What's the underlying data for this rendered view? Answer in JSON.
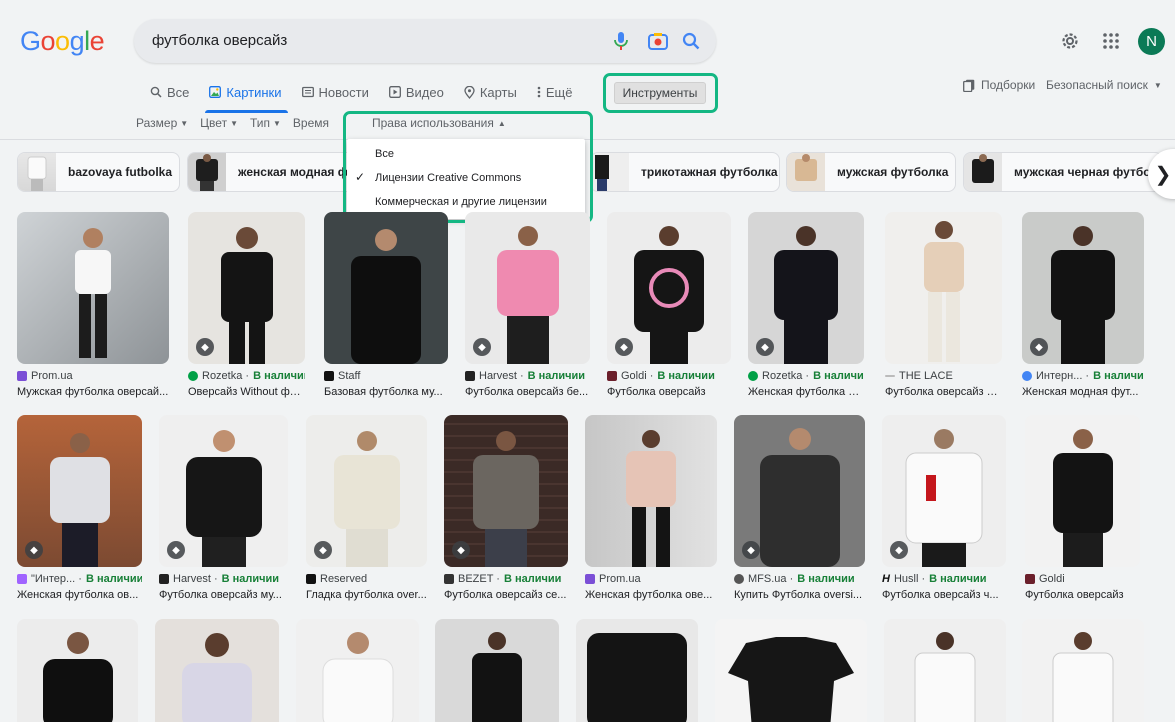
{
  "header": {
    "logo_letters": [
      {
        "ch": "G",
        "color": "#4285f4"
      },
      {
        "ch": "o",
        "color": "#ea4335"
      },
      {
        "ch": "o",
        "color": "#fbbc05"
      },
      {
        "ch": "g",
        "color": "#4285f4"
      },
      {
        "ch": "l",
        "color": "#34a853"
      },
      {
        "ch": "e",
        "color": "#ea4335"
      }
    ],
    "search_query": "футболка оверсайз",
    "avatar_letter": "N"
  },
  "tabs": [
    {
      "label": "Все",
      "icon": "search-icon",
      "active": false
    },
    {
      "label": "Картинки",
      "icon": "image-icon",
      "active": true
    },
    {
      "label": "Новости",
      "icon": "news-icon",
      "active": false
    },
    {
      "label": "Видео",
      "icon": "video-icon",
      "active": false
    },
    {
      "label": "Карты",
      "icon": "map-pin-icon",
      "active": false
    },
    {
      "label": "Ещё",
      "icon": "more-vert-icon",
      "active": false
    }
  ],
  "tools_label": "Инструменты",
  "right_links": {
    "collections": "Подборки",
    "safesearch": "Безопасный поиск"
  },
  "filters": [
    "Размер",
    "Цвет",
    "Тип",
    "Время"
  ],
  "usage_rights": {
    "title": "Права использования",
    "options": [
      {
        "label": "Все",
        "checked": false
      },
      {
        "label": "Лицензии Creative Commons",
        "checked": true
      },
      {
        "label": "Коммерческая и другие лицензии",
        "checked": false
      }
    ]
  },
  "chips": [
    {
      "label": "bazovaya futbolka"
    },
    {
      "label": "женская модная ф"
    },
    {
      "label": "трикотажная футболка"
    },
    {
      "label": "мужская футболка"
    },
    {
      "label": "мужская черная футбол"
    }
  ],
  "accent_color": "#14b783",
  "results": [
    {
      "source": "Prom.ua",
      "available": "",
      "title": "Мужская футболка оверсай...",
      "tag": false
    },
    {
      "source": "Rozetka · ",
      "available": "В наличии",
      "title": "Оверсайз Without фут...",
      "tag": true
    },
    {
      "source": "Staff",
      "available": "",
      "title": "Базовая футболка му...",
      "tag": false
    },
    {
      "source": "Harvest · ",
      "available": "В наличии",
      "title": "Футболка оверсайз бе...",
      "tag": true
    },
    {
      "source": "Goldi · ",
      "available": "В наличии",
      "title": "Футболка оверсайз",
      "tag": true
    },
    {
      "source": "Rozetka · ",
      "available": "В наличии",
      "title": "Женская футболка ов...",
      "tag": true
    },
    {
      "source": "THE LACE",
      "available": "",
      "title": "Футболка оверсайз б...",
      "tag": false
    },
    {
      "source": "Интерн... · ",
      "available": "В наличии",
      "title": "Женская модная фут...",
      "tag": true
    },
    {
      "source": "\"Интер... · ",
      "available": "В наличии",
      "title": "Женская футболка ов...",
      "tag": true
    },
    {
      "source": "Harvest · ",
      "available": "В наличии",
      "title": "Футболка оверсайз му...",
      "tag": true
    },
    {
      "source": "Reserved",
      "available": "",
      "title": "Гладка футболка over...",
      "tag": true
    },
    {
      "source": "BEZET · ",
      "available": "В наличии",
      "title": "Футболка оверсайз се...",
      "tag": true
    },
    {
      "source": "Prom.ua",
      "available": "",
      "title": "Женская футболка ове...",
      "tag": false
    },
    {
      "source": "MFS.ua · ",
      "available": "В наличии",
      "title": "Купить Футболка oversi...",
      "tag": true
    },
    {
      "source": "Husll · ",
      "available": "В наличии",
      "title": "Футболка оверсайз ч...",
      "tag": true
    },
    {
      "source": "Goldi",
      "available": "",
      "title": "Футболка оверсайз",
      "tag": false
    }
  ]
}
